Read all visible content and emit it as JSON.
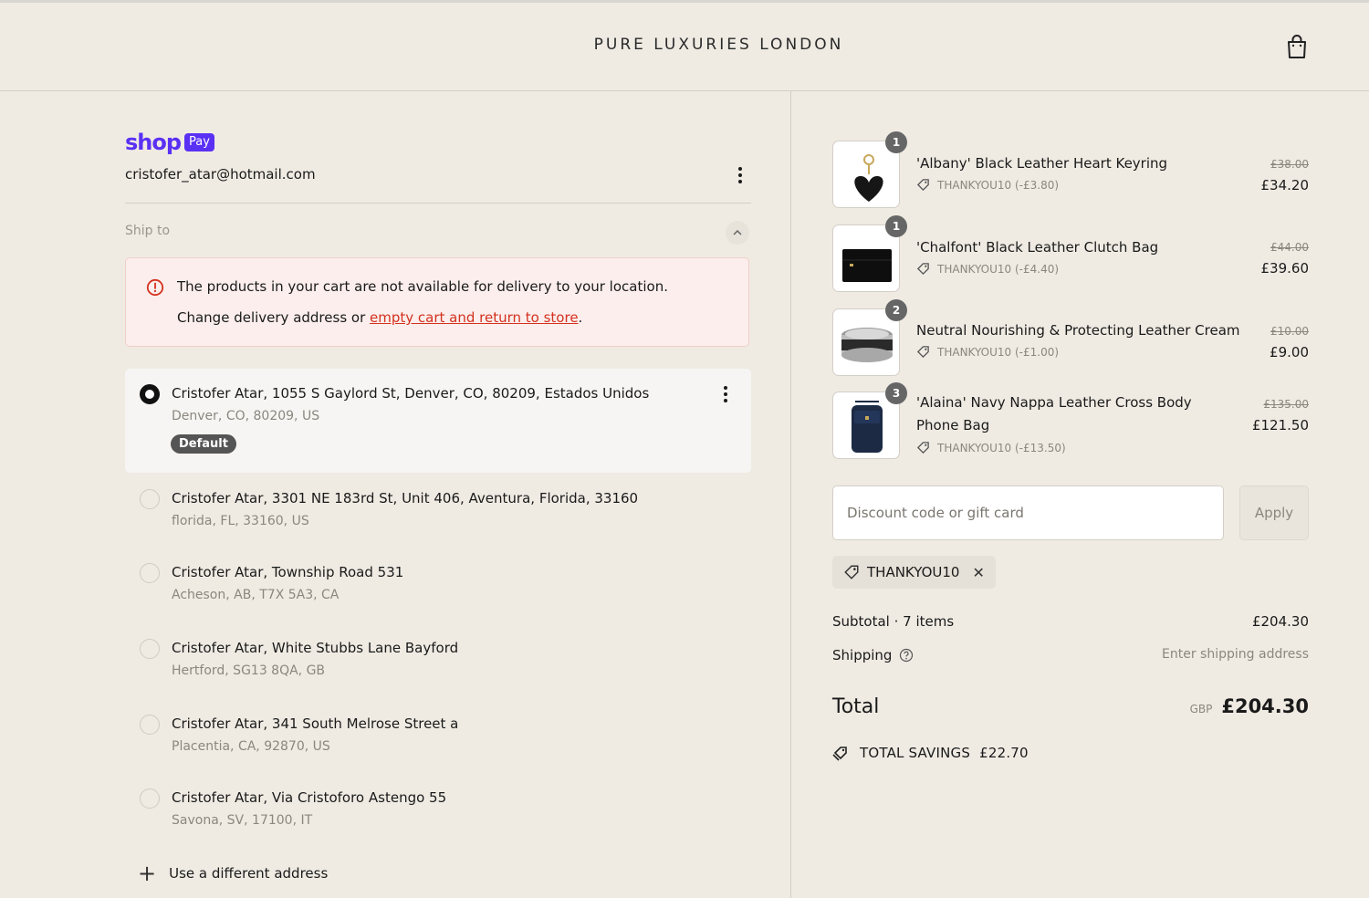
{
  "header": {
    "brand": "PURE LUXURIES LONDON"
  },
  "account": {
    "shop_word": "shop",
    "pay_badge": "Pay",
    "email": "cristofer_atar@hotmail.com"
  },
  "ship_to": {
    "label": "Ship to",
    "alert_title": "The products in your cart are not available for delivery to your location.",
    "alert_prefix": "Change delivery address or ",
    "alert_link": "empty cart and return to store",
    "alert_suffix": "."
  },
  "addresses": [
    {
      "line1": "Cristofer Atar, 1055 S Gaylord St, Denver, CO, 80209, Estados Unidos",
      "line2": "Denver, CO, 80209, US",
      "badge": "Default",
      "selected": true
    },
    {
      "line1": "Cristofer Atar, 3301 NE 183rd St, Unit 406, Aventura, Florida, 33160",
      "line2": "florida, FL, 33160, US"
    },
    {
      "line1": "Cristofer Atar, Township Road 531",
      "line2": "Acheson, AB, T7X 5A3, CA"
    },
    {
      "line1": "Cristofer Atar, White Stubbs Lane Bayford",
      "line2": "Hertford, SG13 8QA, GB"
    },
    {
      "line1": "Cristofer Atar, 341 South Melrose Street a",
      "line2": "Placentia, CA, 92870, US"
    },
    {
      "line1": "Cristofer Atar, Via Cristoforo Astengo 55",
      "line2": "Savona, SV, 17100, IT"
    }
  ],
  "use_different": "Use a different address",
  "items": [
    {
      "qty": "1",
      "name": "'Albany' Black Leather Heart Keyring",
      "discount": "THANKYOU10 (-£3.80)",
      "old_price": "£38.00",
      "price": "£34.20"
    },
    {
      "qty": "1",
      "name": "'Chalfont' Black Leather Clutch Bag",
      "discount": "THANKYOU10 (-£4.40)",
      "old_price": "£44.00",
      "price": "£39.60"
    },
    {
      "qty": "2",
      "name": "Neutral Nourishing & Protecting Leather Cream",
      "discount": "THANKYOU10 (-£1.00)",
      "old_price": "£10.00",
      "price": "£9.00"
    },
    {
      "qty": "3",
      "name": "'Alaina' Navy Nappa Leather Cross Body Phone Bag",
      "discount": "THANKYOU10 (-£13.50)",
      "old_price": "£135.00",
      "price": "£121.50"
    }
  ],
  "discount": {
    "placeholder": "Discount code or gift card",
    "apply_label": "Apply",
    "applied_code": "THANKYOU10"
  },
  "summary": {
    "subtotal_label": "Subtotal · 7 items",
    "subtotal_value": "£204.30",
    "shipping_label": "Shipping",
    "shipping_value": "Enter shipping address",
    "total_label": "Total",
    "currency": "GBP",
    "total_value": "£204.30",
    "savings_label": "TOTAL SAVINGS",
    "savings_value": "£22.70"
  },
  "colors": {
    "accent": "#5a31f4",
    "error": "#d4311f",
    "background": "#efebe3"
  }
}
